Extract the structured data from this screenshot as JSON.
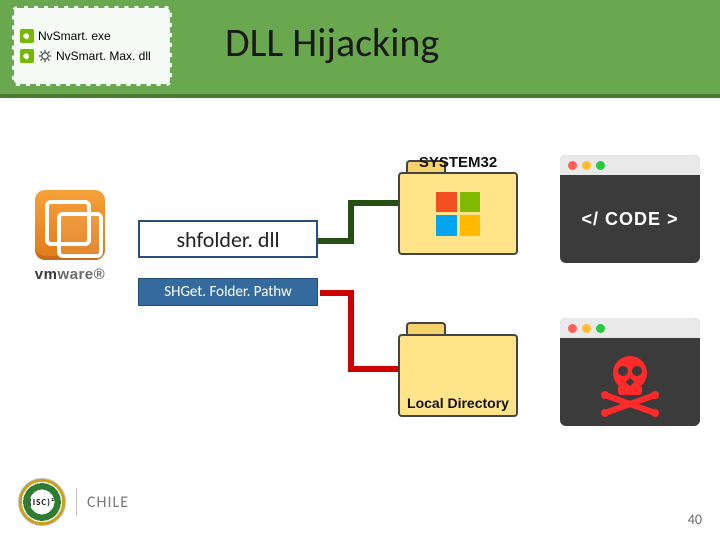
{
  "header": {
    "title": "DLL Hijacking"
  },
  "fileList": {
    "items": [
      {
        "name": "NvSmart. exe"
      },
      {
        "name": "NvSmart. Max. dll"
      }
    ]
  },
  "vmware": {
    "word_prefix": "vm",
    "word_suffix": "ware"
  },
  "dll": {
    "file_label": "shfolder. dll",
    "function_label": "SHGet. Folder. Pathw"
  },
  "folders": {
    "system": {
      "label": "SYSTEM32"
    },
    "local": {
      "label": "Local Directory"
    }
  },
  "codePanel": {
    "text": "</ CODE >"
  },
  "footer": {
    "chapter": "CHILE",
    "badge_text": "(ISC)²",
    "page_number": "40"
  }
}
